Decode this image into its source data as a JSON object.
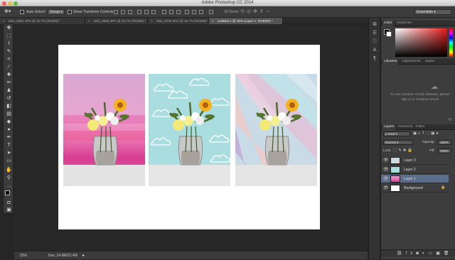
{
  "app": {
    "title": "Adobe Photoshop CC 2014"
  },
  "options_bar": {
    "auto_select_label": "Auto-Select:",
    "auto_select_value": "Group",
    "show_transform_label": "Show Transform Controls",
    "mode_3d_label": "3D Mode:",
    "workspace": "Essentials"
  },
  "tabs": [
    {
      "label": "IMG_9691.JPG @ 16.7% (RGB/8) *",
      "active": false
    },
    {
      "label": "IMG_9692.JPG @ 16.7% (RGB/8) *",
      "active": false
    },
    {
      "label": "IMG_9700.JPG @ 16.7% (RGB/8) *",
      "active": false
    },
    {
      "label": "Untitled-1 @ 25% (Layer 1, RGB/8#) *",
      "active": true
    }
  ],
  "status": {
    "zoom": "25%",
    "doc": "Doc: 24.9M/21.4M"
  },
  "panels": {
    "color_tabs": [
      "Color",
      "Swatches"
    ],
    "libraries_tabs": [
      "Libraries",
      "Adjustments",
      "Styles"
    ],
    "libraries_message": "To use Creative Cloud Libraries, please sign in to Creative Cloud.",
    "layers_tabs": [
      "Layers",
      "Channels",
      "Paths"
    ],
    "kind_label": "Kind",
    "blend_mode": "Normal",
    "opacity_label": "Opacity:",
    "opacity_value": "100%",
    "lock_label": "Lock:",
    "fill_label": "Fill:",
    "fill_value": "100%",
    "layers": [
      {
        "name": "Layer 3",
        "selected": false
      },
      {
        "name": "Layer 2",
        "selected": false
      },
      {
        "name": "Layer 1",
        "selected": true
      },
      {
        "name": "Background",
        "selected": false
      }
    ]
  },
  "colors": {
    "ui_dark": "#282828",
    "panel": "#3d3d3d",
    "selected_layer": "#5c6e8c"
  }
}
